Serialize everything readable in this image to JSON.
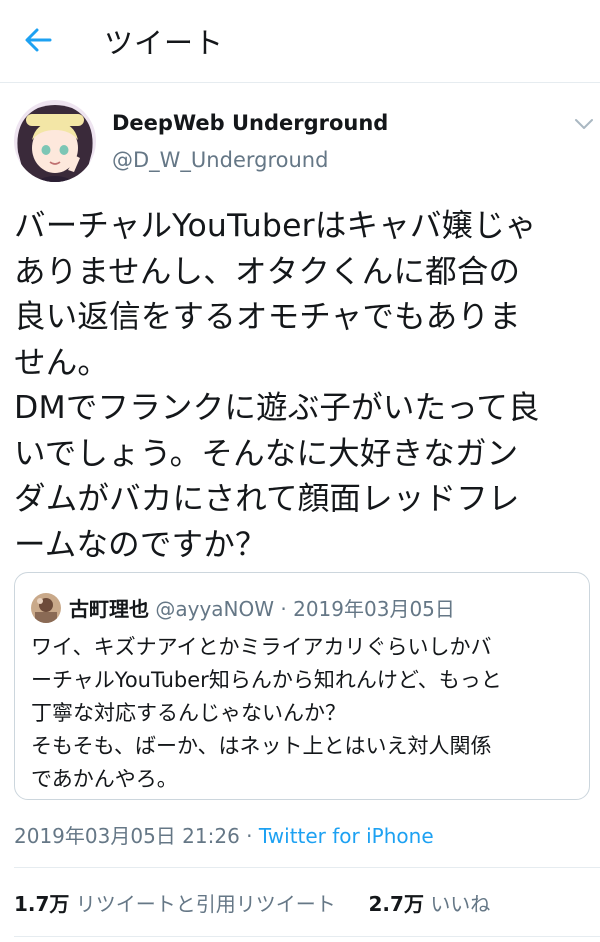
{
  "header": {
    "title": "ツイート"
  },
  "icons": {
    "back": "arrow-left-icon",
    "more": "chevron-down-icon"
  },
  "tweet": {
    "display_name": "DeepWeb Underground",
    "handle": "@D_W_Underground",
    "text": "バーチャルYouTuberはキャバ嬢じゃ\nありませんし、オタクくんに都合の\n良い返信をするオモチャでもありま\nせん。\nDMでフランクに遊ぶ子がいたって良\nいでしょう。そんなに大好きなガン\nダムがバカにされて顔面レッドフレ\nームなのですか？",
    "timestamp": "2019年03月05日 21:26",
    "separator": " · ",
    "source": "Twitter for iPhone"
  },
  "quote": {
    "display_name": "古町理也",
    "handle": "@ayyaNOW",
    "separator": " · ",
    "date": "2019年03月05日",
    "text": "ワイ、キズナアイとかミライアカリぐらいしかバ\nーチャルYouTuber知らんから知れんけど、もっと\n丁寧な対応するんじゃないんか？\nそもそも、ばーか、はネット上とはいえ対人関係\nであかんやろ。"
  },
  "stats": {
    "retweets_count": "1.7万",
    "retweets_label": "リツイートと引用リツイート",
    "likes_count": "2.7万",
    "likes_label": "いいね"
  },
  "colors": {
    "accent": "#1da1f2",
    "text_primary": "#14171a",
    "text_secondary": "#657786",
    "divider": "#e6ecf0"
  }
}
